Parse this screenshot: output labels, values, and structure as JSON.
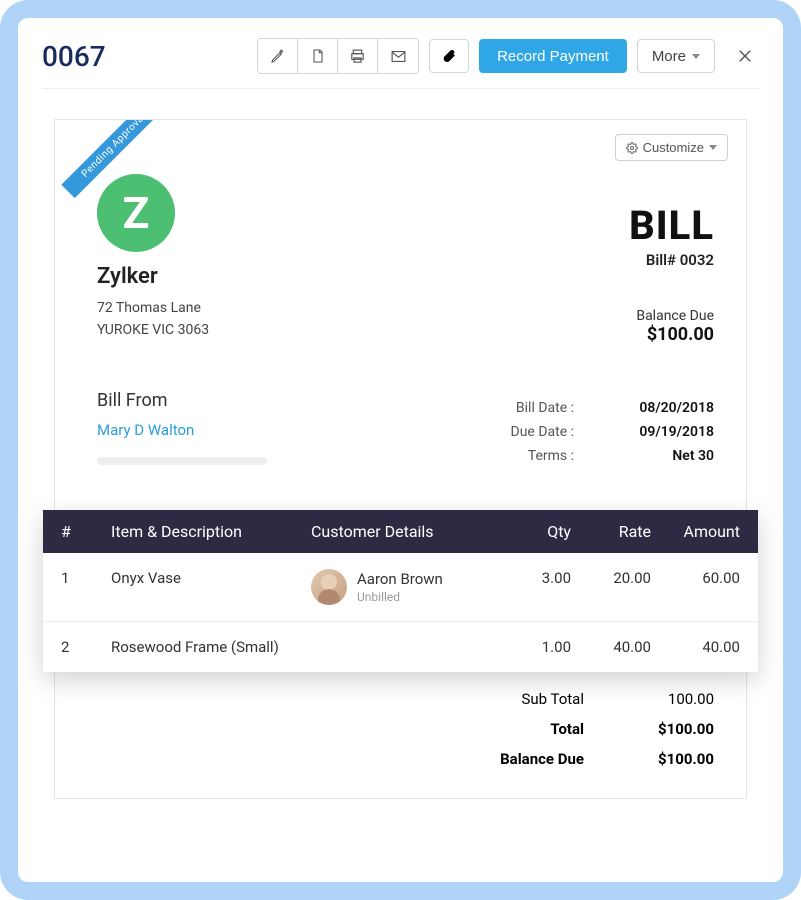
{
  "header": {
    "page_number": "0067",
    "record_payment_label": "Record Payment",
    "more_label": "More"
  },
  "bill": {
    "ribbon_label": "Pending Approval",
    "customize_label": "Customize",
    "vendor": {
      "logo_letter": "Z",
      "name": "Zylker",
      "address_line1": "72 Thomas Lane",
      "address_line2": "YUROKE VIC 3063"
    },
    "title": "BILL",
    "number_label": "Bill# 0032",
    "balance_label": "Balance Due",
    "balance_amount": "$100.00",
    "bill_from_heading": "Bill From",
    "bill_from_name": "Mary D Walton",
    "meta": {
      "bill_date_label": "Bill Date :",
      "bill_date_value": "08/20/2018",
      "due_date_label": "Due Date :",
      "due_date_value": "09/19/2018",
      "terms_label": "Terms :",
      "terms_value": "Net 30"
    },
    "columns": {
      "num": "#",
      "item": "Item & Description",
      "customer": "Customer Details",
      "qty": "Qty",
      "rate": "Rate",
      "amount": "Amount"
    },
    "items": [
      {
        "num": "1",
        "name": "Onyx Vase",
        "customer_name": "Aaron Brown",
        "customer_status": "Unbilled",
        "qty": "3.00",
        "rate": "20.00",
        "amount": "60.00"
      },
      {
        "num": "2",
        "name": "Rosewood Frame (Small)",
        "customer_name": "",
        "customer_status": "",
        "qty": "1.00",
        "rate": "40.00",
        "amount": "40.00"
      }
    ],
    "totals": {
      "subtotal_label": "Sub Total",
      "subtotal_value": "100.00",
      "total_label": "Total",
      "total_value": "$100.00",
      "balance_due_label": "Balance Due",
      "balance_due_value": "$100.00"
    }
  }
}
